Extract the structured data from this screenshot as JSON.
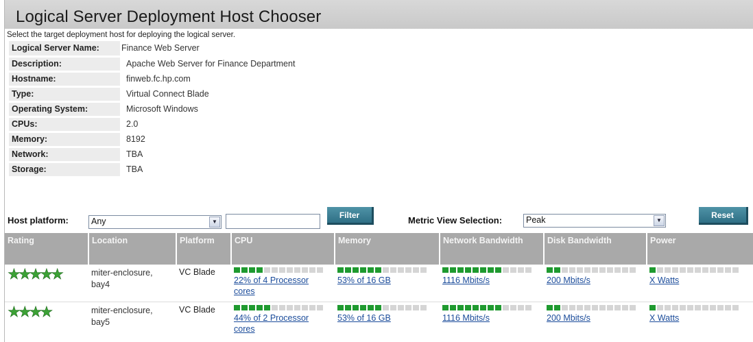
{
  "page": {
    "title": "Logical Server Deployment Host Chooser",
    "subtitle": "Select the target deployment host for deploying the logical server."
  },
  "server_info": [
    {
      "label": "Logical Server Name:",
      "value": "Finance Web Server"
    },
    {
      "label": "Description:",
      "value": "Apache Web Server for Finance Department"
    },
    {
      "label": "Hostname:",
      "value": "finweb.fc.hp.com"
    },
    {
      "label": "Type:",
      "value": "Virtual Connect Blade"
    },
    {
      "label": "Operating System:",
      "value": "Microsoft Windows"
    },
    {
      "label": "CPUs:",
      "value": "2.0"
    },
    {
      "label": "Memory:",
      "value": "8192"
    },
    {
      "label": "Network:",
      "value": "TBA"
    },
    {
      "label": "Storage:",
      "value": "TBA"
    }
  ],
  "filters": {
    "host_platform_label": "Host platform:",
    "host_platform_value": "Any",
    "filter_text_value": "",
    "filter_button": "Filter",
    "metric_view_label": "Metric View Selection:",
    "metric_view_value": "Peak",
    "reset_button": "Reset"
  },
  "table": {
    "headers": {
      "rating": "Rating",
      "location": "Location",
      "platform": "Platform",
      "cpu": "CPU",
      "memory": "Memory",
      "network": "Network Bandwidth",
      "disk": "Disk Bandwidth",
      "power": "Power"
    },
    "rows": [
      {
        "rating": 5,
        "location": "miter-enclosure, bay4",
        "platform": "VC Blade",
        "cpu": "22% of 4 Processor cores",
        "memory": "53% of 16 GB",
        "network": "1116 Mbits/s",
        "disk": "200 Mbits/s",
        "power": "X Watts"
      },
      {
        "rating": 4,
        "location": "miter-enclosure, bay5",
        "platform": "VC Blade",
        "cpu": "44% of 2 Processor cores",
        "memory": "53% of 16 GB",
        "network": "1116 Mbits/s",
        "disk": "200 Mbits/s",
        "power": "X Watts"
      }
    ]
  },
  "colors": {
    "header_bg": "#a9a9a9",
    "button": "#3a7f95",
    "bar_on": "#1f9a2f",
    "bar_off": "#d5d5d5",
    "star": "#3ca236",
    "link": "#1a4b9a"
  }
}
